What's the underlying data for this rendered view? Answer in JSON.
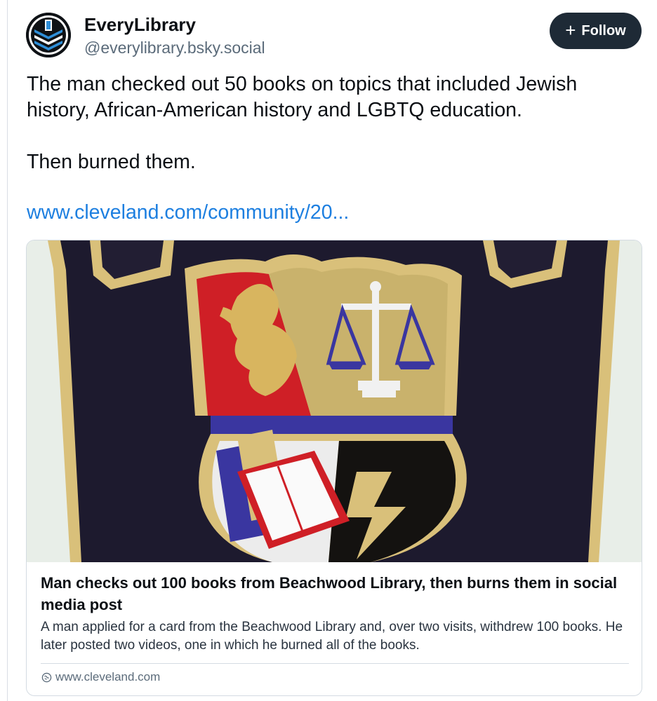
{
  "author": {
    "display_name": "EveryLibrary",
    "handle": "@everylibrary.bsky.social",
    "avatar_icon": "everylibrary-stack-logo"
  },
  "follow_button": {
    "label": "Follow",
    "icon": "plus-icon",
    "background": "#1e2a36"
  },
  "post": {
    "paragraph_1": "The man checked out 50 books on topics that included Jewish history, African-American history and LGBTQ education.",
    "paragraph_2": "Then burned them.",
    "link_text": "www.cleveland.com/community/20..."
  },
  "link_card": {
    "image_icon": "embroidered-library-patch",
    "title": "Man checks out 100 books from Beachwood Library, then burns them in social media post",
    "description": "A man applied for a card from the Beachwood Library and, over two visits, withdrew 100 books. He later posted two videos, one in which he burned all of the books.",
    "source": "www.cleveland.com",
    "source_icon": "globe-icon"
  },
  "colors": {
    "link": "#1d7fe0",
    "text": "#0b0f14",
    "muted": "#5b6b7a",
    "border": "#d4dbe2"
  }
}
